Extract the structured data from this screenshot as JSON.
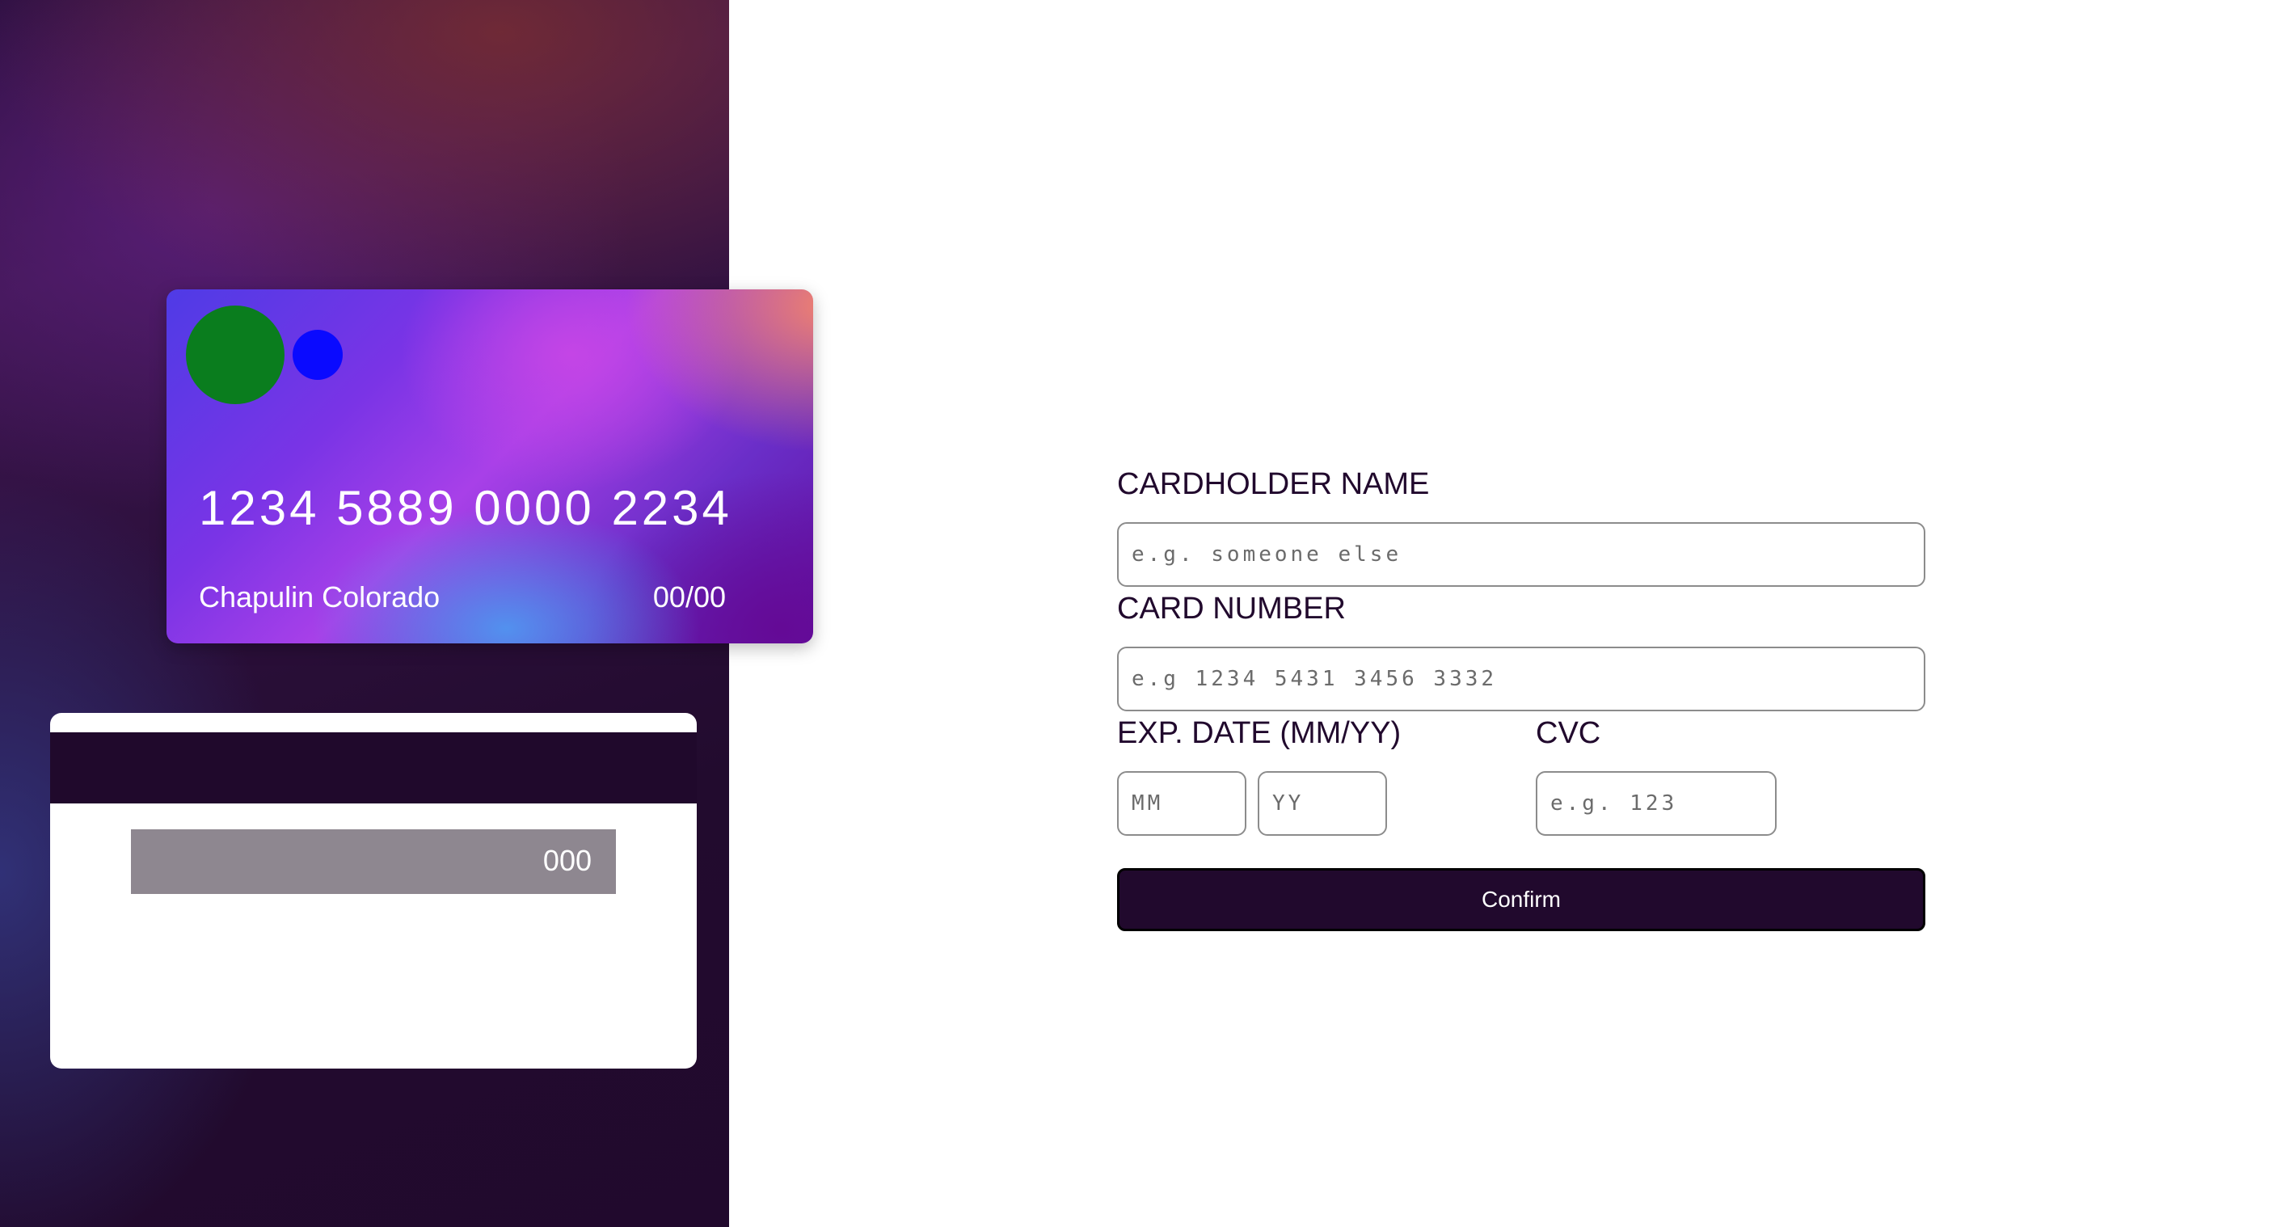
{
  "card_front": {
    "number": "1234 5889 0000 2234",
    "name": "Chapulin Colorado",
    "expiry": "00/00",
    "logo_colors": {
      "large": "#0a7d1e",
      "small": "#0a0aff"
    }
  },
  "card_back": {
    "cvc": "000",
    "stripe_color": "#20092c"
  },
  "form": {
    "cardholder": {
      "label": "CARDHOLDER NAME",
      "placeholder": "e.g. someone else",
      "value": ""
    },
    "card_number": {
      "label": "CARD NUMBER",
      "placeholder": "e.g 1234 5431 3456 3332",
      "value": ""
    },
    "exp_date": {
      "label": "EXP. DATE (MM/YY)",
      "month_placeholder": "MM",
      "year_placeholder": "YY"
    },
    "cvc": {
      "label": "CVC",
      "placeholder": "e.g. 123"
    },
    "confirm_label": "Confirm"
  },
  "colors": {
    "accent": "#21092d",
    "page_background": "#ffffff"
  }
}
